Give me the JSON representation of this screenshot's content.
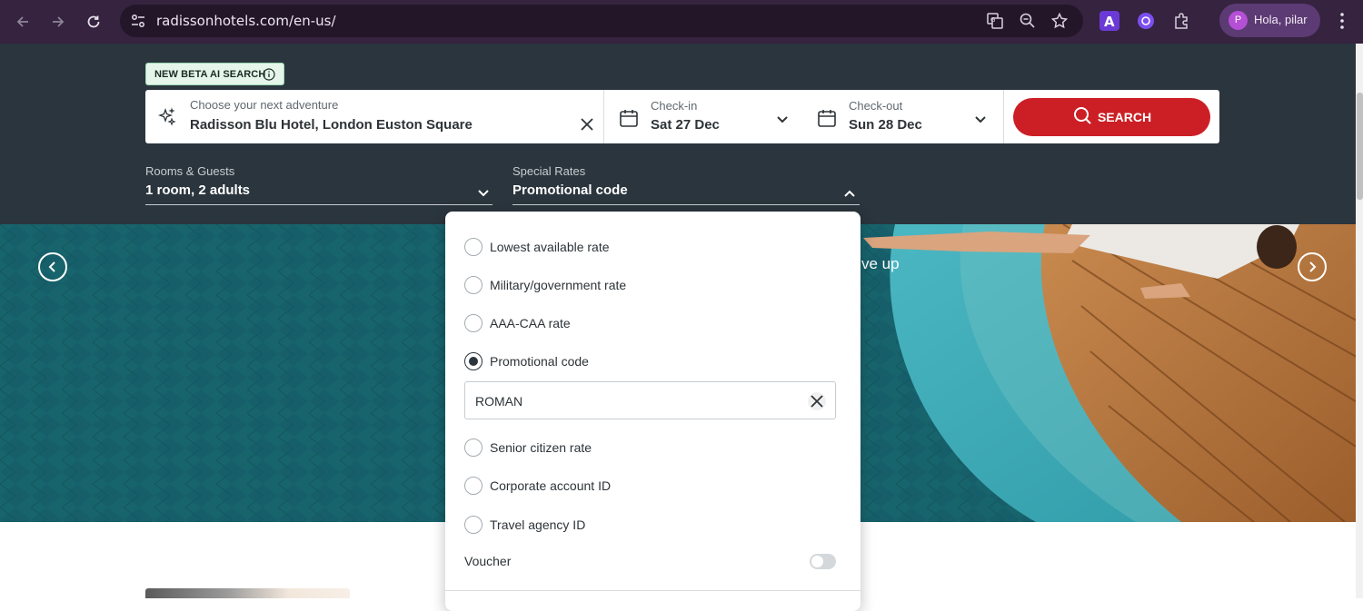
{
  "browser": {
    "url": "radissonhotels.com/en-us/",
    "profile_initial": "P",
    "profile_name": "Hola, pilar"
  },
  "search": {
    "beta_badge": "NEW BETA AI SEARCH",
    "destination": {
      "label": "Choose your next adventure",
      "value": "Radisson Blu Hotel, London Euston Square"
    },
    "checkin": {
      "label": "Check-in",
      "value": "Sat 27 Dec"
    },
    "checkout": {
      "label": "Check-out",
      "value": "Sun 28 Dec"
    },
    "search_button": "SEARCH",
    "rooms": {
      "label": "Rooms & Guests",
      "value": "1 room, 2 adults"
    },
    "special_rates": {
      "label": "Special Rates",
      "value": "Promotional code"
    }
  },
  "hero": {
    "partial_text": "ve up"
  },
  "rates_dropdown": {
    "options": [
      {
        "label": "Lowest available rate",
        "checked": false
      },
      {
        "label": "Military/government rate",
        "checked": false
      },
      {
        "label": "AAA-CAA rate",
        "checked": false
      },
      {
        "label": "Promotional code",
        "checked": true
      },
      {
        "label": "Senior citizen rate",
        "checked": false
      },
      {
        "label": "Corporate account ID",
        "checked": false
      },
      {
        "label": "Travel agency ID",
        "checked": false
      }
    ],
    "promo_code_value": "ROMAN",
    "voucher_label": "Voucher",
    "voucher_enabled": false
  },
  "colors": {
    "brand_red": "#cc1f25",
    "header_dark": "#2b353d",
    "browser_chrome": "#35233f"
  }
}
